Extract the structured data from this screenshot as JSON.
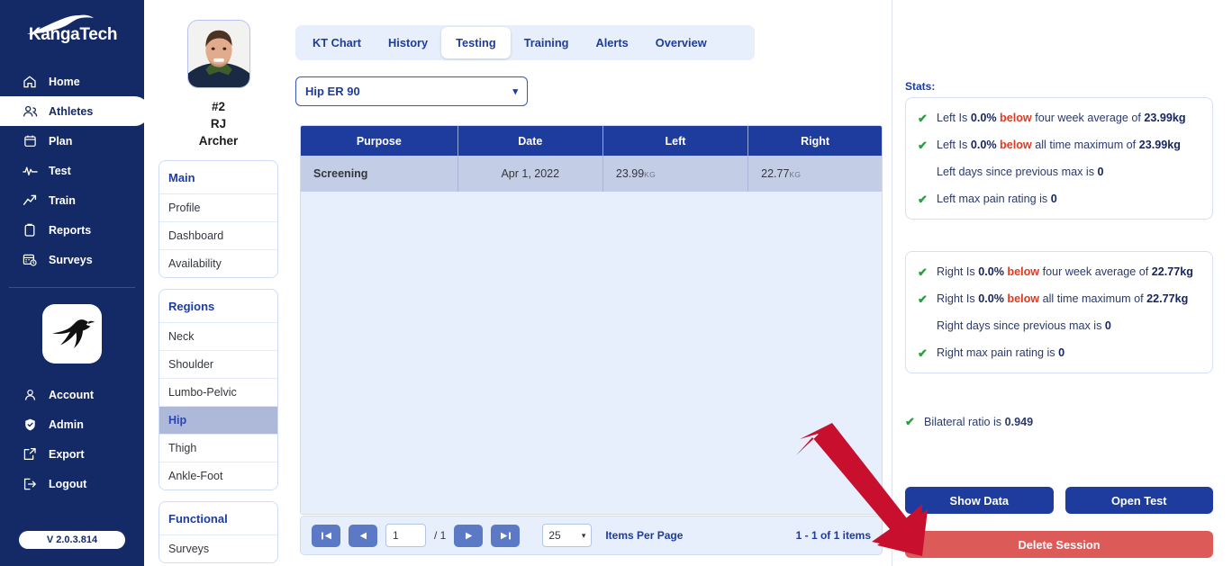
{
  "app": {
    "brand": "KangaTech",
    "version": "V 2.0.3.814"
  },
  "sidebar": {
    "items": [
      {
        "label": "Home",
        "icon": "home-icon",
        "active": false
      },
      {
        "label": "Athletes",
        "icon": "people-icon",
        "active": true
      },
      {
        "label": "Plan",
        "icon": "calendar-icon",
        "active": false
      },
      {
        "label": "Test",
        "icon": "pulse-icon",
        "active": false
      },
      {
        "label": "Train",
        "icon": "trend-up-icon",
        "active": false
      },
      {
        "label": "Reports",
        "icon": "clipboard-icon",
        "active": false
      },
      {
        "label": "Surveys",
        "icon": "survey-icon",
        "active": false
      }
    ],
    "bottom_items": [
      {
        "label": "Account",
        "icon": "person-icon"
      },
      {
        "label": "Admin",
        "icon": "shield-icon"
      },
      {
        "label": "Export",
        "icon": "export-icon"
      },
      {
        "label": "Logout",
        "icon": "logout-icon"
      }
    ]
  },
  "athlete": {
    "number": "#2",
    "first_name": "RJ",
    "last_name": "Archer",
    "panels": [
      {
        "title": "Main",
        "rows": [
          {
            "label": "Profile",
            "selected": false
          },
          {
            "label": "Dashboard",
            "selected": false
          },
          {
            "label": "Availability",
            "selected": false
          }
        ]
      },
      {
        "title": "Regions",
        "rows": [
          {
            "label": "Neck",
            "selected": false
          },
          {
            "label": "Shoulder",
            "selected": false
          },
          {
            "label": "Lumbo-Pelvic",
            "selected": false
          },
          {
            "label": "Hip",
            "selected": true
          },
          {
            "label": "Thigh",
            "selected": false
          },
          {
            "label": "Ankle-Foot",
            "selected": false
          }
        ]
      },
      {
        "title": "Functional",
        "rows": [
          {
            "label": "Surveys",
            "selected": false
          }
        ]
      }
    ]
  },
  "main": {
    "tabs": [
      {
        "label": "KT Chart",
        "active": false
      },
      {
        "label": "History",
        "active": false
      },
      {
        "label": "Testing",
        "active": true
      },
      {
        "label": "Training",
        "active": false
      },
      {
        "label": "Alerts",
        "active": false
      },
      {
        "label": "Overview",
        "active": false
      }
    ],
    "test_select": {
      "value": "Hip ER 90"
    },
    "table": {
      "columns": [
        "Purpose",
        "Date",
        "Left",
        "Right"
      ],
      "rows": [
        {
          "purpose": "Screening",
          "date": "Apr 1, 2022",
          "left_value": "23.99",
          "left_unit": "KG",
          "right_value": "22.77",
          "right_unit": "KG"
        }
      ]
    },
    "pager": {
      "page_value": "1",
      "page_total": "/ 1",
      "page_size": "25",
      "page_size_label": "Items Per Page",
      "range_text": "1 - 1 of 1 items"
    }
  },
  "stats": {
    "heading": "Stats:",
    "left_card": [
      {
        "check": true,
        "parts": [
          {
            "t": "Left Is ",
            "s": "n"
          },
          {
            "t": "0.0%",
            "s": "b"
          },
          {
            "t": " ",
            "s": "n"
          },
          {
            "t": "below",
            "s": "d"
          },
          {
            "t": " four week average of ",
            "s": "n"
          },
          {
            "t": "23.99kg",
            "s": "b"
          }
        ]
      },
      {
        "check": true,
        "parts": [
          {
            "t": "Left Is ",
            "s": "n"
          },
          {
            "t": "0.0%",
            "s": "b"
          },
          {
            "t": " ",
            "s": "n"
          },
          {
            "t": "below",
            "s": "d"
          },
          {
            "t": " all time maximum of ",
            "s": "n"
          },
          {
            "t": "23.99kg",
            "s": "b"
          }
        ]
      },
      {
        "check": false,
        "parts": [
          {
            "t": "Left days since previous max is ",
            "s": "n"
          },
          {
            "t": "0",
            "s": "b"
          }
        ]
      },
      {
        "check": true,
        "parts": [
          {
            "t": "Left max pain rating is ",
            "s": "n"
          },
          {
            "t": "0",
            "s": "b"
          }
        ]
      }
    ],
    "right_card": [
      {
        "check": true,
        "parts": [
          {
            "t": "Right Is ",
            "s": "n"
          },
          {
            "t": "0.0%",
            "s": "b"
          },
          {
            "t": " ",
            "s": "n"
          },
          {
            "t": "below",
            "s": "d"
          },
          {
            "t": " four week average of ",
            "s": "n"
          },
          {
            "t": "22.77kg",
            "s": "b"
          }
        ]
      },
      {
        "check": true,
        "parts": [
          {
            "t": "Right Is ",
            "s": "n"
          },
          {
            "t": "0.0%",
            "s": "b"
          },
          {
            "t": " ",
            "s": "n"
          },
          {
            "t": "below",
            "s": "d"
          },
          {
            "t": " all time maximum of ",
            "s": "n"
          },
          {
            "t": "22.77kg",
            "s": "b"
          }
        ]
      },
      {
        "check": false,
        "parts": [
          {
            "t": "Right days since previous max is ",
            "s": "n"
          },
          {
            "t": "0",
            "s": "b"
          }
        ]
      },
      {
        "check": true,
        "parts": [
          {
            "t": "Right max pain rating is ",
            "s": "n"
          },
          {
            "t": "0",
            "s": "b"
          }
        ]
      }
    ],
    "bilateral": {
      "check": true,
      "parts": [
        {
          "t": "Bilateral ratio is ",
          "s": "n"
        },
        {
          "t": "0.949",
          "s": "b"
        }
      ]
    },
    "buttons": {
      "show_data": "Show Data",
      "open_test": "Open Test",
      "delete_session": "Delete Session"
    }
  },
  "colors": {
    "nav_bg": "#142a67",
    "accent_blue": "#1d3c9e",
    "tab_strip": "#e8effc",
    "row_selected": "#c4cde6",
    "danger": "#dc5a58",
    "check_green": "#24a33c",
    "below_red": "#e23a20",
    "annotation_arrow": "#c8102e"
  }
}
